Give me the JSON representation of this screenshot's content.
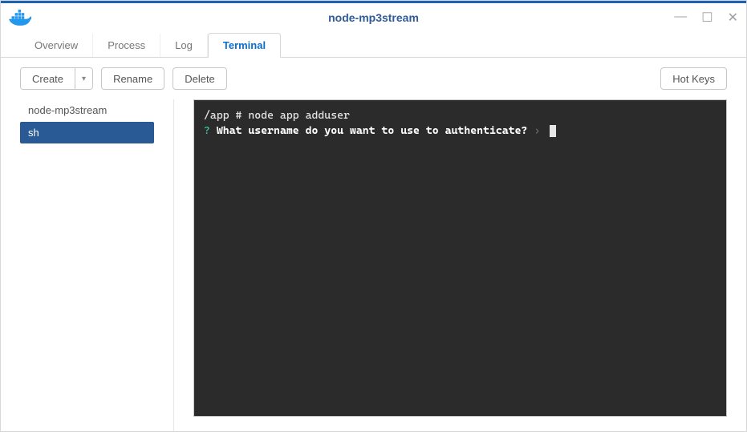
{
  "window": {
    "title": "node-mp3stream"
  },
  "tabs": {
    "overview": "Overview",
    "process": "Process",
    "log": "Log",
    "terminal": "Terminal",
    "active": "terminal"
  },
  "toolbar": {
    "create": "Create",
    "rename": "Rename",
    "delete": "Delete",
    "hotkeys": "Hot Keys"
  },
  "sidebar": {
    "items": [
      {
        "label": "node-mp3stream",
        "active": false
      },
      {
        "label": "sh",
        "active": true
      }
    ]
  },
  "terminal": {
    "line1_prompt": "/app # ",
    "line1_cmd": "node app adduser",
    "line2_marker": "?",
    "line2_question": "What username do you want to use to authenticate?",
    "line2_caret": "›"
  }
}
